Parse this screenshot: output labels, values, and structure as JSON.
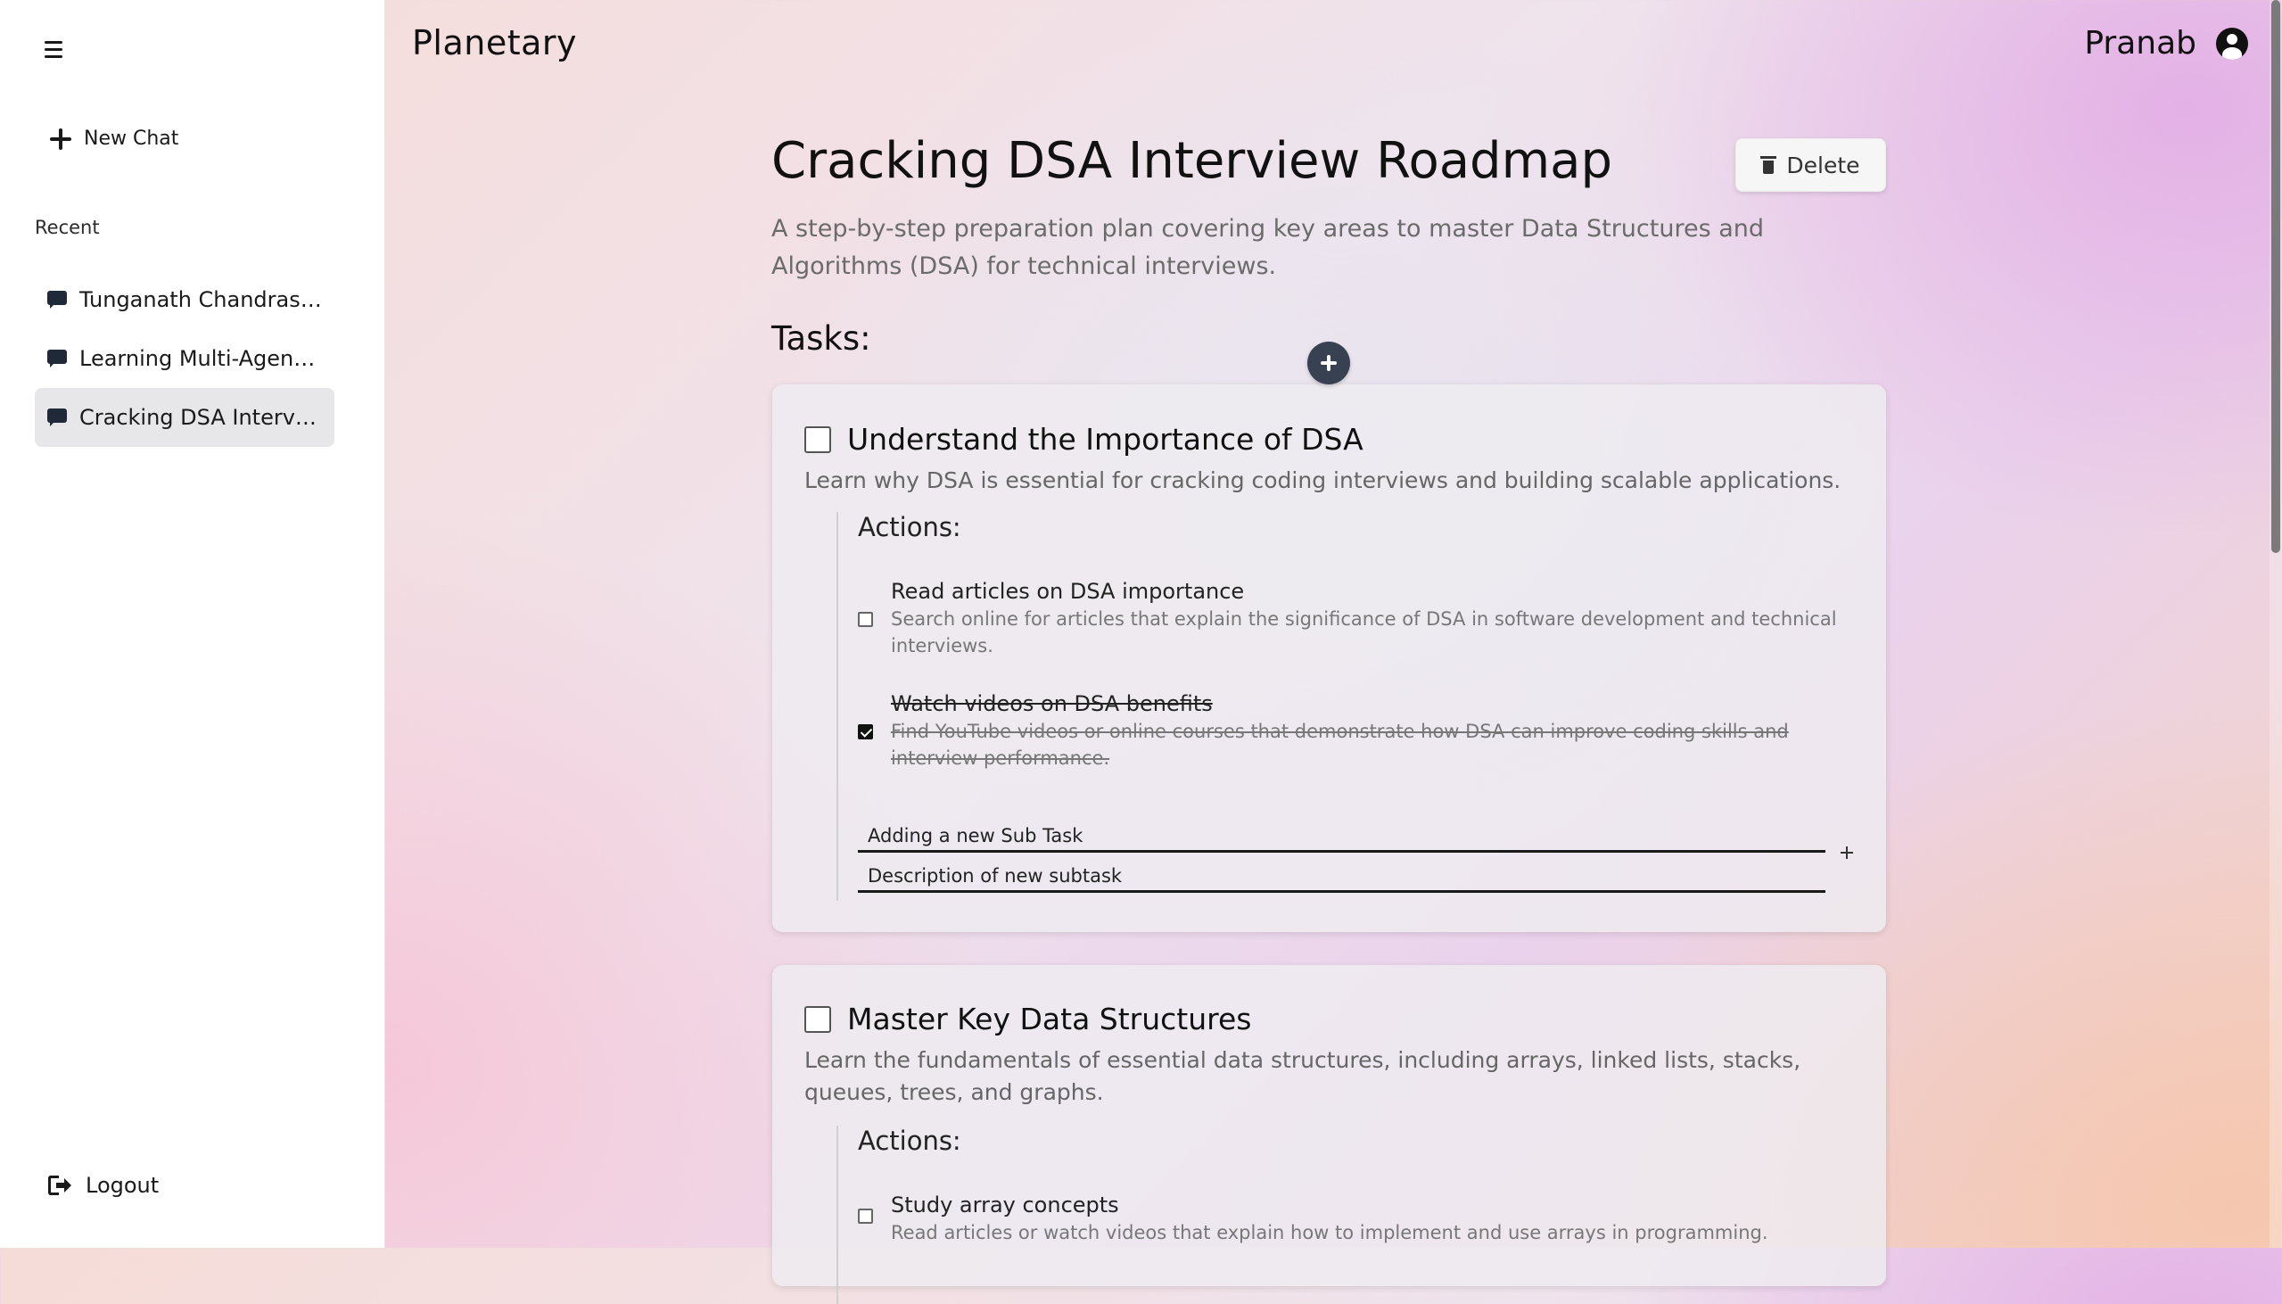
{
  "app": {
    "title": "Planetary"
  },
  "user": {
    "name": "Pranab"
  },
  "sidebar": {
    "new_chat": "New Chat",
    "recent_label": "Recent",
    "items": [
      {
        "label": "Tunganath Chandrashila Trek",
        "active": false
      },
      {
        "label": "Learning Multi-Agent Systems",
        "active": false
      },
      {
        "label": "Cracking DSA Interview Roadmap",
        "active": true
      }
    ],
    "logout": "Logout"
  },
  "main": {
    "title": "Cracking DSA Interview Roadmap",
    "delete_label": "Delete",
    "description": "A step-by-step preparation plan covering key areas to master Data Structures and Algorithms (DSA) for technical interviews.",
    "tasks_heading": "Tasks:",
    "tasks": [
      {
        "title": "Understand the Importance of DSA",
        "description": "Learn why DSA is essential for cracking coding interviews and building scalable applications.",
        "actions_label": "Actions:",
        "subtasks": [
          {
            "title": "Read articles on DSA importance",
            "description": "Search online for articles that explain the significance of DSA in software development and technical interviews.",
            "done": false
          },
          {
            "title": "Watch videos on DSA benefits",
            "description": "Find YouTube videos or online courses that demonstrate how DSA can improve coding skills and interview performance.",
            "done": true
          }
        ],
        "new_subtask": {
          "title_value": "Adding a new Sub Task",
          "description_value": "Description of new subtask"
        }
      },
      {
        "title": "Master Key Data Structures",
        "description": "Learn the fundamentals of essential data structures, including arrays, linked lists, stacks, queues, trees, and graphs.",
        "actions_label": "Actions:",
        "subtasks": [
          {
            "title": "Study array concepts",
            "description": "Read articles or watch videos that explain how to implement and use arrays in programming.",
            "done": false
          }
        ]
      }
    ]
  }
}
